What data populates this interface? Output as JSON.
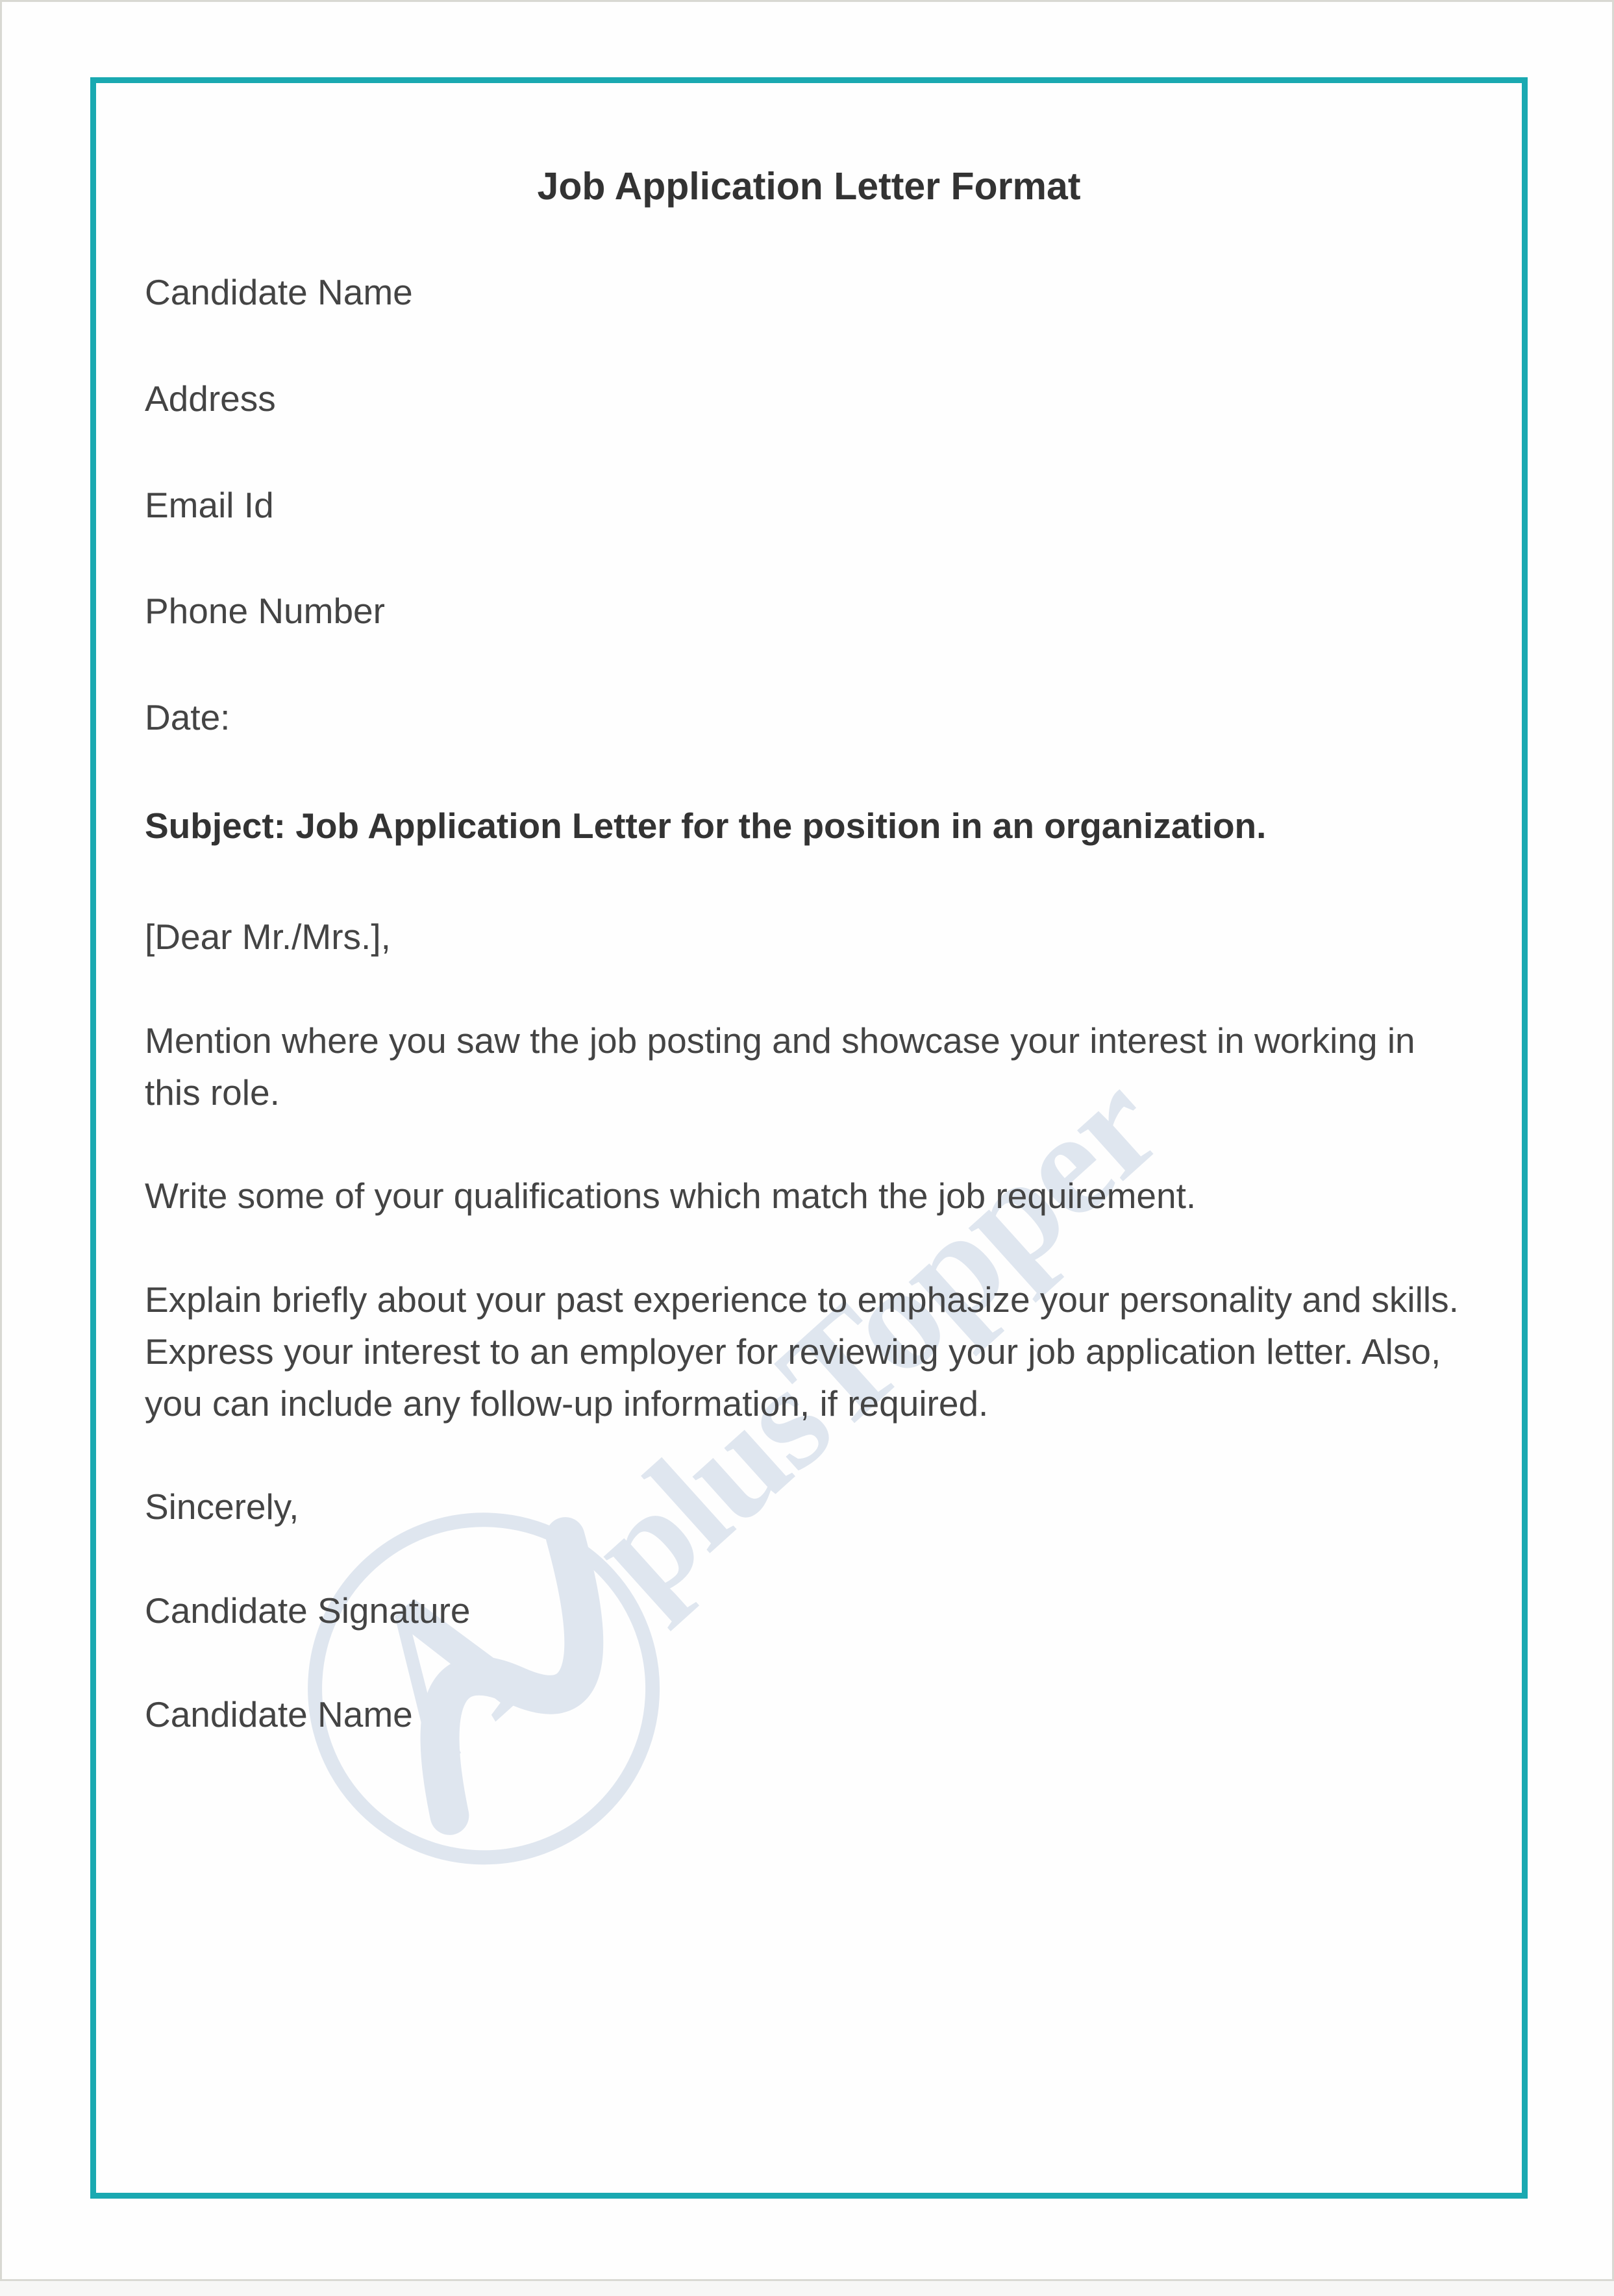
{
  "document": {
    "title": "Job Application Letter Format",
    "fields": {
      "candidate_name": "Candidate Name",
      "address": "Address",
      "email_id": "Email Id",
      "phone_number": "Phone Number",
      "date": "Date:"
    },
    "subject": "Subject: Job Application Letter for the position in an organization.",
    "salutation": "[Dear Mr./Mrs.],",
    "paragraphs": {
      "p1": "Mention where you saw the job posting and showcase your interest in working in this role.",
      "p2": "Write some of your qualifications which match the job requirement.",
      "p3": "Explain briefly about your past experience to emphasize your personality and skills. Express your interest to an employer for reviewing your job application letter. Also, you can include any follow-up information, if required."
    },
    "closing": "Sincerely,",
    "signature": "Candidate Signature",
    "name_line": "Candidate Name"
  },
  "watermark": {
    "text": "plusTopper"
  },
  "colors": {
    "border_teal": "#1aa9b1",
    "text_dark": "#333333",
    "text_body": "#444444",
    "watermark_blue": "#2c5a99"
  }
}
